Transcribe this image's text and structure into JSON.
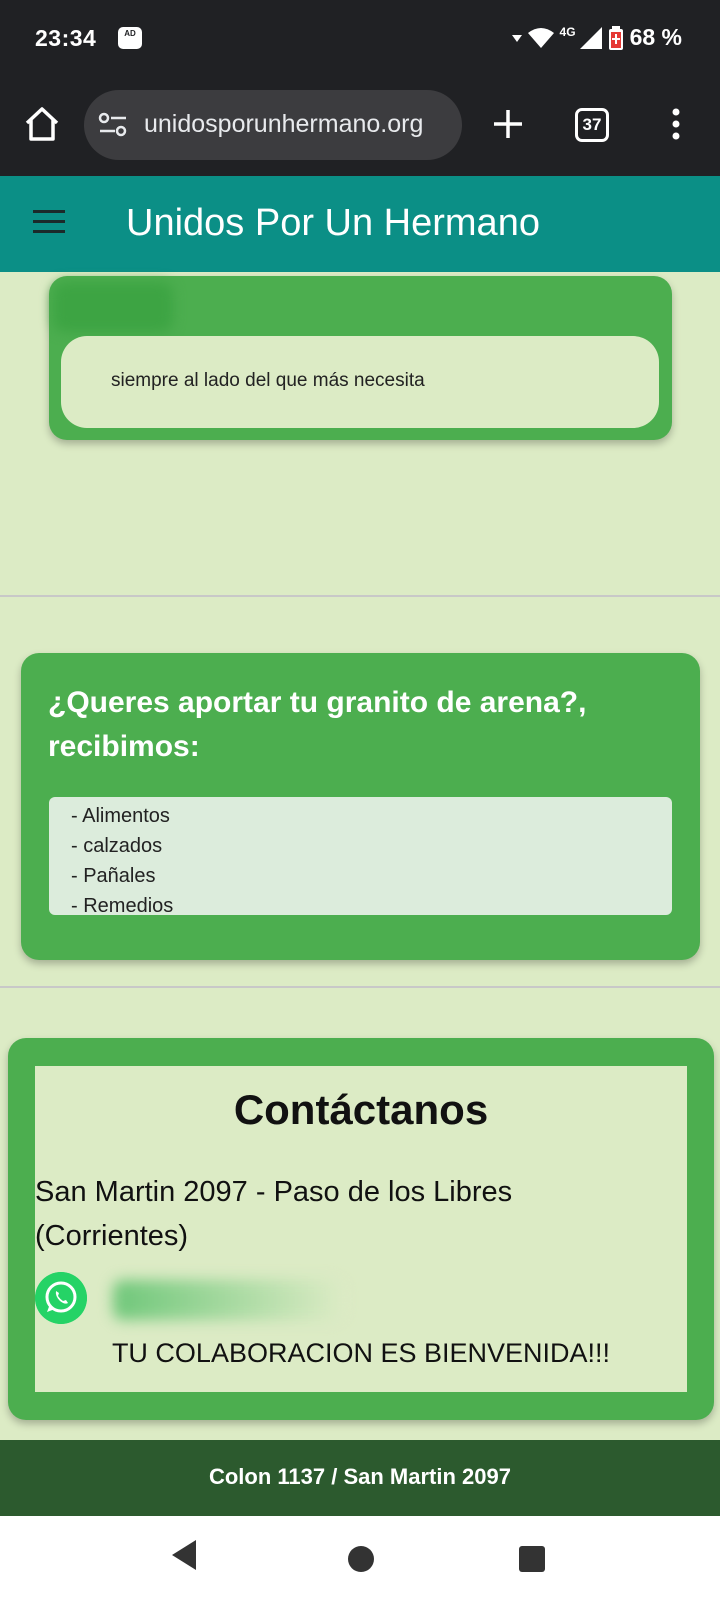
{
  "status_bar": {
    "time": "23:34",
    "ad_icon": "AD",
    "network": "4G",
    "battery": "68 %"
  },
  "browser": {
    "url": "unidosporunhermano.org",
    "tab_count": "37"
  },
  "site": {
    "title": "Unidos Por Un Hermano",
    "colors": {
      "header": "#0b8f86",
      "card": "#4cae4f",
      "background": "#dcebc5",
      "footer": "#2c5a2e"
    }
  },
  "hero": {
    "slogan": "siempre al lado del que más necesita"
  },
  "donations": {
    "title": "¿Queres aportar tu granito de arena?, recibimos:",
    "items": [
      "- Alimentos",
      "- calzados",
      "- Pañales",
      "- Remedios"
    ]
  },
  "contact": {
    "title": "Contáctanos",
    "address": "San Martin 2097 - Paso de los Libres (Corrientes)",
    "whatsapp_icon": "whatsapp-icon",
    "welcome": "TU COLABORACION ES BIENVENIDA!!!"
  },
  "footer": {
    "text": "Colon 1137 / San Martin 2097"
  }
}
